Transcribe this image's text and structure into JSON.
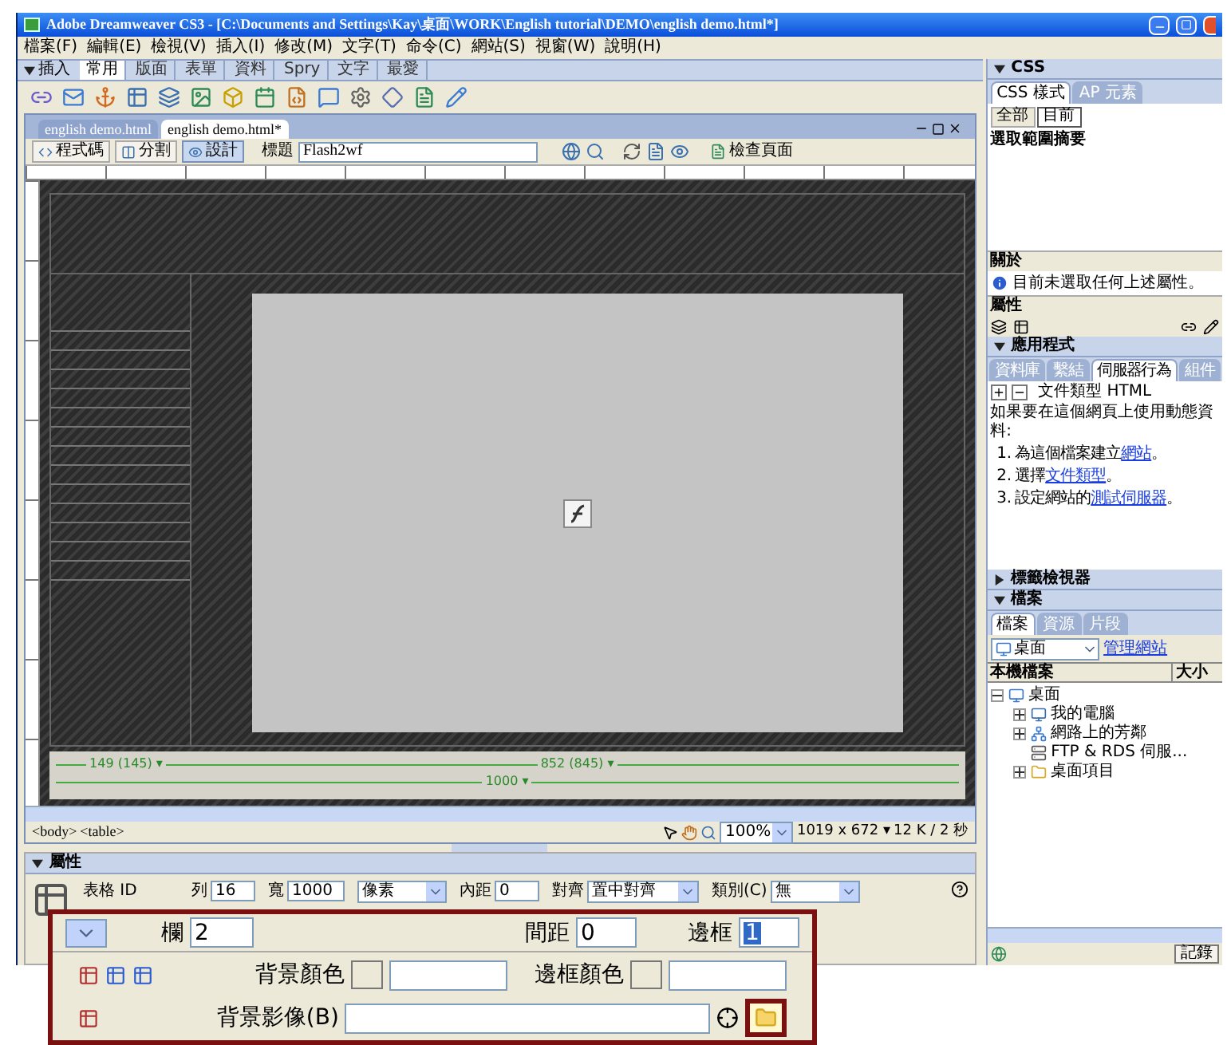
{
  "window": {
    "title": "Adobe Dreamweaver CS3 - [C:\\Documents and Settings\\Kay\\桌面\\WORK\\English tutorial\\DEMO\\english demo.html*]"
  },
  "menu": [
    "檔案(F)",
    "編輯(E)",
    "檢視(V)",
    "插入(I)",
    "修改(M)",
    "文字(T)",
    "命令(C)",
    "網站(S)",
    "視窗(W)",
    "說明(H)"
  ],
  "insert_bar": {
    "title": "插入",
    "expanded": true,
    "tabs": [
      {
        "label": "常用",
        "selected": true
      },
      {
        "label": "版面",
        "selected": false
      },
      {
        "label": "表單",
        "selected": false
      },
      {
        "label": "資料",
        "selected": false
      },
      {
        "label": "Spry",
        "selected": false
      },
      {
        "label": "文字",
        "selected": false
      },
      {
        "label": "最愛",
        "selected": false
      }
    ]
  },
  "document": {
    "tabs": [
      {
        "label": "english demo.html",
        "selected": false
      },
      {
        "label": "english demo.html*",
        "selected": true
      }
    ],
    "views": [
      {
        "label": "程式碼",
        "selected": false
      },
      {
        "label": "分割",
        "selected": false
      },
      {
        "label": "設計",
        "selected": true
      }
    ],
    "title_label": "標題",
    "title_value": "Flash2wf",
    "check_page": "檢查頁面",
    "width_guides": {
      "left": "149 (145) ▾",
      "right": "852 (845) ▾",
      "total": "1000 ▾"
    }
  },
  "status_bar": {
    "tags": [
      "<body>",
      "<table>"
    ],
    "zoom": "100%",
    "window_size": "1019 x 672 ▾",
    "download": "12 K / 2 秒"
  },
  "properties": {
    "title": "屬性",
    "expanded": true,
    "table_id_label": "表格 ID",
    "fields": [
      {
        "label": "列",
        "value": "16",
        "kind": "text"
      },
      {
        "label": "寬",
        "value": "1000",
        "kind": "text"
      },
      {
        "value": "像素",
        "kind": "select"
      },
      {
        "label": "內距",
        "value": "0",
        "kind": "text"
      },
      {
        "label": "對齊",
        "value": "置中對齊",
        "kind": "select"
      },
      {
        "label": "類別(C)",
        "value": "無",
        "kind": "select"
      }
    ]
  },
  "zoomed_properties": {
    "cols_label": "欄",
    "cols_value": "2",
    "spacing_label": "間距",
    "spacing_value": "0",
    "border": {
      "label": "邊框",
      "value": "1",
      "selected": true
    },
    "bg_color_label": "背景顏色",
    "border_color_label": "邊框顏色",
    "bg_image_label": "背景影像(B)"
  },
  "css_panel": {
    "title": "CSS",
    "expanded": true,
    "tabs": [
      {
        "label": "CSS 樣式",
        "selected": true
      },
      {
        "label": "AP 元素",
        "selected": false
      }
    ],
    "modes": [
      {
        "label": "全部",
        "selected": false
      },
      {
        "label": "目前",
        "selected": true
      }
    ],
    "summary_title": "選取範圍摘要",
    "about_title": "關於",
    "about_text": "目前未選取任何上述屬性。",
    "properties_title": "屬性"
  },
  "application_panel": {
    "title": "應用程式",
    "expanded": true,
    "tabs": [
      {
        "label": "資料庫",
        "selected": false
      },
      {
        "label": "繫結",
        "selected": false
      },
      {
        "label": "伺服器行為",
        "selected": true
      },
      {
        "label": "組件",
        "selected": false
      }
    ],
    "doc_type": "文件類型 HTML",
    "intro": "如果要在這個網頁上使用動態資料:",
    "steps": [
      {
        "number": "1.",
        "before": "為這個檔案建立",
        "link": "網站",
        "after": "。"
      },
      {
        "number": "2.",
        "before": "選擇",
        "link": "文件類型",
        "after": "。"
      },
      {
        "number": "3.",
        "before": "設定網站的",
        "link": "測試伺服器",
        "after": "。"
      }
    ]
  },
  "tag_inspector": {
    "title": "標籤檢視器",
    "expanded": false
  },
  "files_panel": {
    "title": "檔案",
    "expanded": true,
    "tabs": [
      {
        "label": "檔案",
        "selected": true
      },
      {
        "label": "資源",
        "selected": false
      },
      {
        "label": "片段",
        "selected": false
      }
    ],
    "location": "桌面",
    "manage_link": "管理網站",
    "columns": [
      "本機檔案",
      "大小"
    ],
    "tree": [
      {
        "label": "桌面",
        "kind": "desktop",
        "has_children": true,
        "expanded": true,
        "children": [
          {
            "label": "我的電腦",
            "kind": "computer",
            "has_children": true
          },
          {
            "label": "網路上的芳鄰",
            "kind": "network",
            "has_children": true
          },
          {
            "label": "FTP & RDS 伺服...",
            "kind": "server",
            "has_children": false
          },
          {
            "label": "桌面項目",
            "kind": "folder",
            "has_children": true
          }
        ]
      }
    ]
  },
  "log_button": "記錄"
}
